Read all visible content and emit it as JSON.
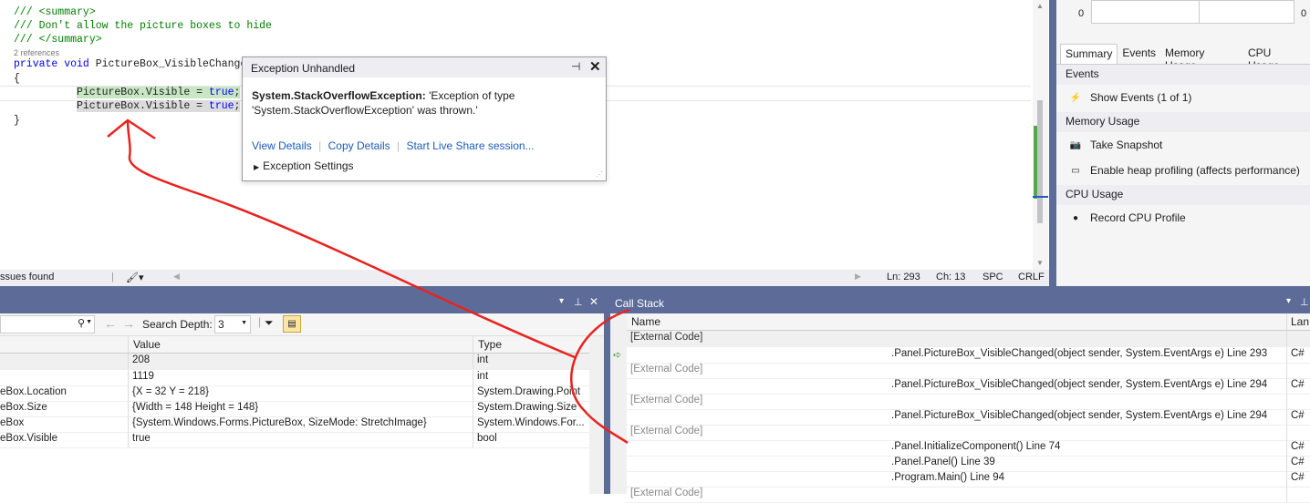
{
  "editor": {
    "line1": "/// <summary>",
    "line2": "/// Don't allow the picture boxes to hide",
    "line3": "/// </summary>",
    "refs": "2 references",
    "line4_kw": "private void",
    "line4_rest": " PictureBox_VisibleChanged(",
    "line5": "{",
    "line6_a": "PictureBox.Visible = ",
    "line6_kw": "true",
    "line6_b": ";",
    "line7_a": "PictureBox.Visible = ",
    "line7_kw": "true",
    "line7_b": ";",
    "line8": "}"
  },
  "exception": {
    "title": "Exception Unhandled",
    "pin_icon": "pin-icon",
    "close_icon": "close-icon",
    "type": "System.StackOverflowException:",
    "message_1": " 'Exception of type",
    "message_2": "'System.StackOverflowException' was thrown.'",
    "view_details": "View Details",
    "copy_details": "Copy Details",
    "live_share": "Start Live Share session...",
    "settings": "Exception Settings"
  },
  "statusbar": {
    "issues": "ssues found",
    "line": "Ln: 293",
    "col": "Ch: 13",
    "spc": "SPC",
    "crlf": "CRLF"
  },
  "diagnostics": {
    "timeline_left": "0",
    "timeline_right": "0",
    "tabs": [
      "Summary",
      "Events",
      "Memory Usage",
      "CPU Usage"
    ],
    "events_header": "Events",
    "show_events": "Show Events (1 of 1)",
    "memory_header": "Memory Usage",
    "take_snapshot": "Take Snapshot",
    "heap_profiling": "Enable heap profiling (affects performance)",
    "cpu_header": "CPU Usage",
    "record_cpu": "Record CPU Profile"
  },
  "locals": {
    "search_depth_label": "Search Depth:",
    "search_depth_value": "3",
    "columns": {
      "value": "Value",
      "type": "Type"
    },
    "rows": [
      {
        "name": "",
        "value": "208",
        "type": "int"
      },
      {
        "name": "",
        "value": "1119",
        "type": "int"
      },
      {
        "name": "eBox.Location",
        "value": "{X = 32 Y = 218}",
        "type": "System.Drawing.Point"
      },
      {
        "name": "eBox.Size",
        "value": "{Width = 148 Height = 148}",
        "type": "System.Drawing.Size"
      },
      {
        "name": "eBox",
        "value": "{System.Windows.Forms.PictureBox, SizeMode: StretchImage}",
        "type": "System.Windows.For..."
      },
      {
        "name": "eBox.Visible",
        "value": "true",
        "type": "bool"
      }
    ]
  },
  "callstack": {
    "title": "Call Stack",
    "columns": {
      "name": "Name",
      "lang": "Lan"
    },
    "rows": [
      {
        "left": "[External Code]",
        "right": "",
        "lang": ""
      },
      {
        "left": "",
        "right": ".Panel.PictureBox_VisibleChanged(object sender, System.EventArgs e) Line 293",
        "lang": "C#"
      },
      {
        "left": "[External Code]",
        "right": "",
        "lang": ""
      },
      {
        "left": "",
        "right": ".Panel.PictureBox_VisibleChanged(object sender, System.EventArgs e) Line 294",
        "lang": "C#"
      },
      {
        "left": "[External Code]",
        "right": "",
        "lang": ""
      },
      {
        "left": "",
        "right": ".Panel.PictureBox_VisibleChanged(object sender, System.EventArgs e) Line 294",
        "lang": "C#"
      },
      {
        "left": "[External Code]",
        "right": "",
        "lang": ""
      },
      {
        "left": "",
        "right": ".Panel.InitializeComponent() Line 74",
        "lang": "C#"
      },
      {
        "left": "",
        "right": ".Panel.Panel() Line 39",
        "lang": "C#"
      },
      {
        "left": "",
        "right": ".Program.Main() Line 94",
        "lang": "C#"
      },
      {
        "left": "[External Code]",
        "right": "",
        "lang": ""
      }
    ]
  }
}
